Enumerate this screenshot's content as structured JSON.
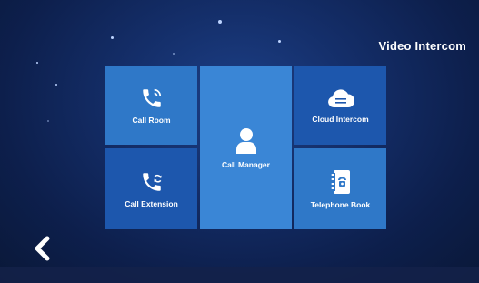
{
  "header": {
    "title": "Video Intercom"
  },
  "tiles": {
    "call_room": {
      "label": "Call Room",
      "icon": "phone-wave-icon"
    },
    "call_manager": {
      "label": "Call Manager",
      "icon": "person-icon"
    },
    "cloud_intercom": {
      "label": "Cloud Intercom",
      "icon": "cloud-icon"
    },
    "call_extension": {
      "label": "Call Extension",
      "icon": "phone-transfer-icon"
    },
    "telephone_book": {
      "label": "Telephone Book",
      "icon": "phone-book-icon"
    }
  },
  "nav": {
    "back_icon": "chevron-left-icon"
  },
  "colors": {
    "tile_light": "#2f78c8",
    "tile_dark": "#1d57ad",
    "tile_manager": "#3a86d6",
    "background": "#142e69"
  }
}
